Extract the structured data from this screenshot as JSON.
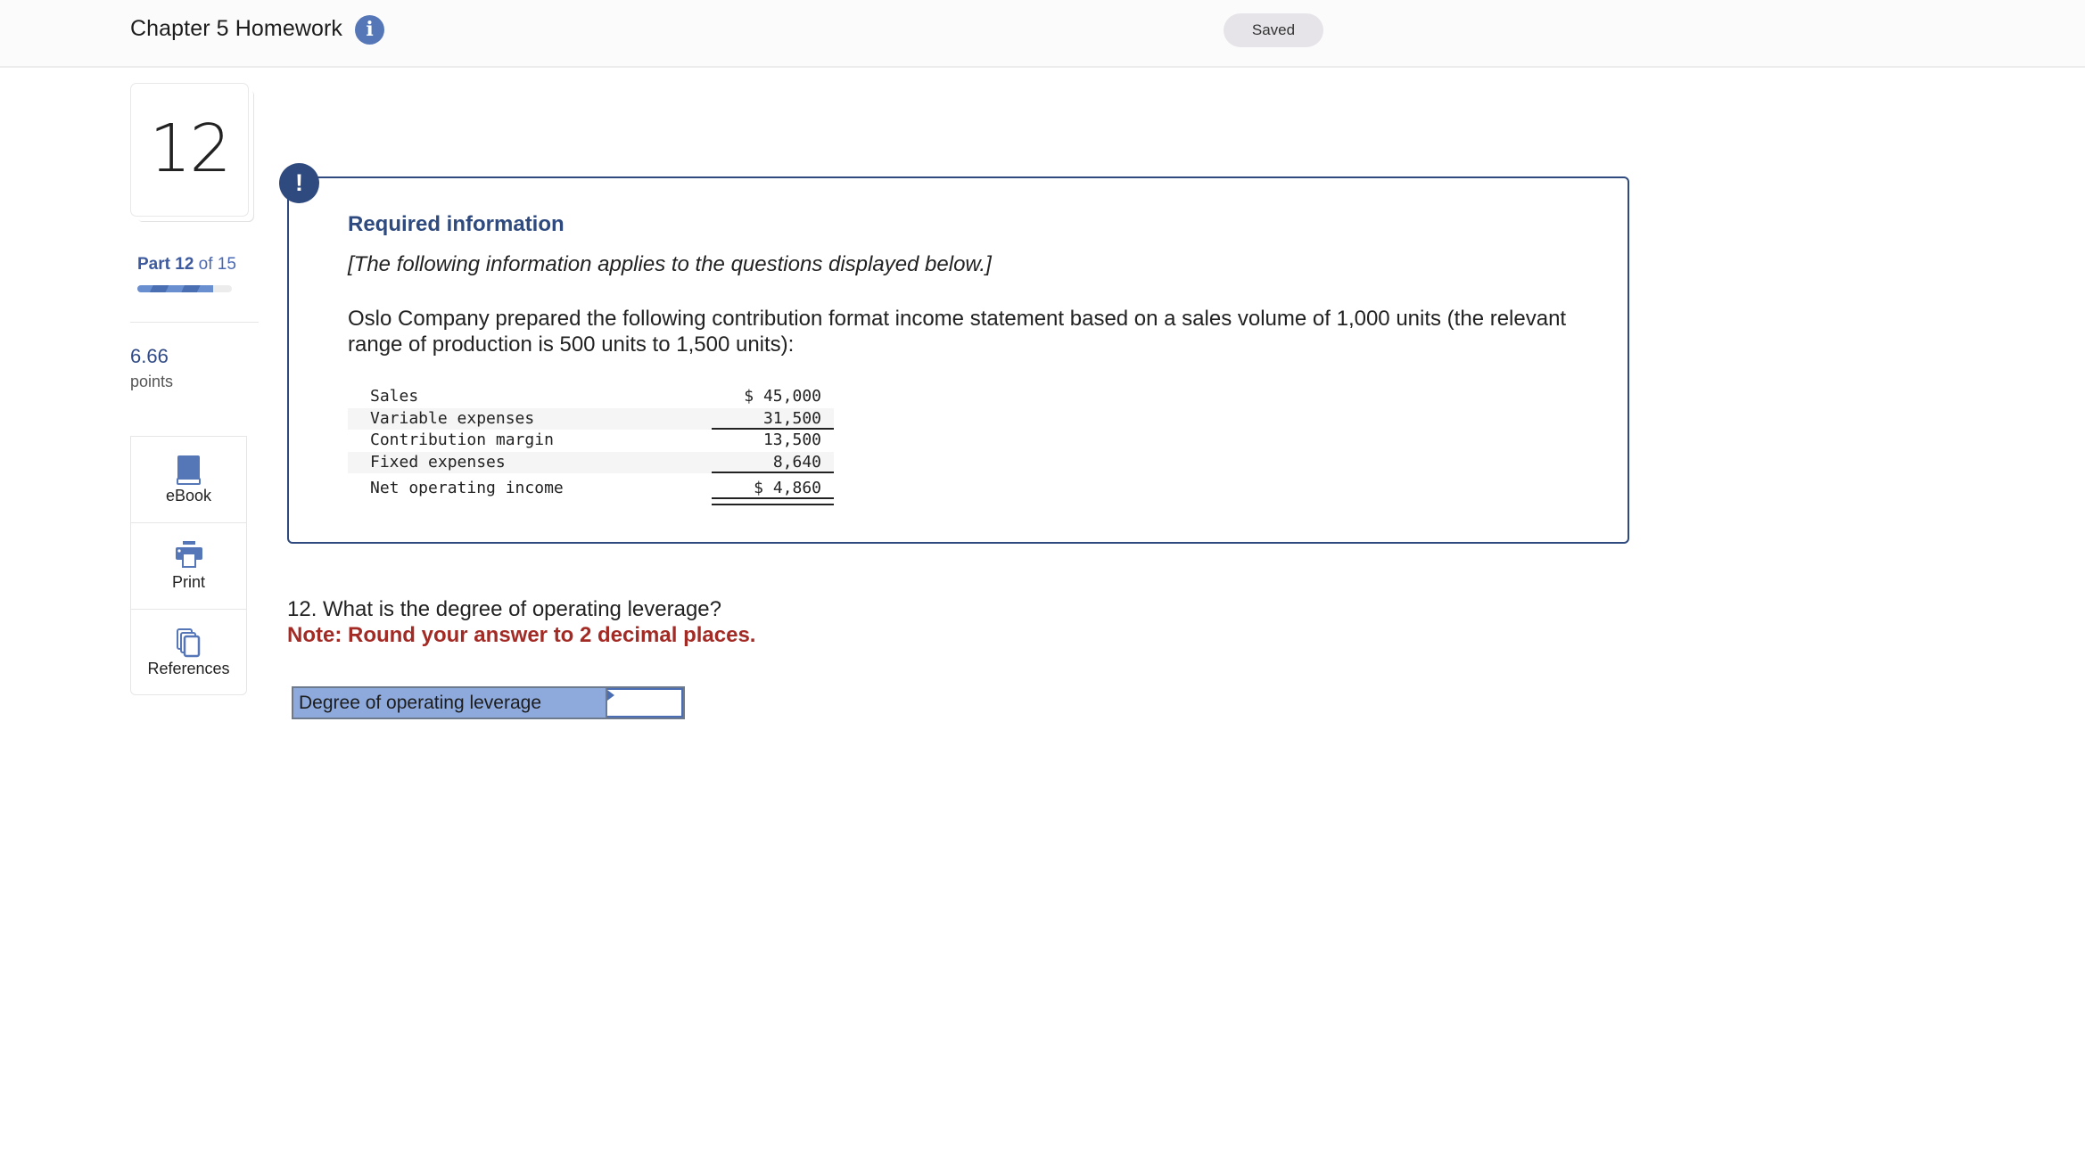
{
  "header": {
    "title": "Chapter 5 Homework",
    "info_icon": "info-icon",
    "save_status": "Saved"
  },
  "question_nav": {
    "number": "12",
    "part_prefix": "Part",
    "part_current": "12",
    "part_suffix": "of 15",
    "progress": {
      "current": 12,
      "total": 15
    },
    "points_value": "6.66",
    "points_label": "points"
  },
  "tools": [
    {
      "label": "eBook",
      "icon": "book-icon"
    },
    {
      "label": "Print",
      "icon": "printer-icon"
    },
    {
      "label": "References",
      "icon": "copy-pages-icon"
    }
  ],
  "required_info": {
    "badge": "!",
    "title": "Required information",
    "subtitle": "[The following information applies to the questions displayed below.]",
    "paragraph": "Oslo Company prepared the following contribution format income statement based on a sales volume of 1,000 units (the relevant range of production is 500 units to 1,500 units):",
    "statement": [
      {
        "label": "Sales",
        "amount": "$ 45,000"
      },
      {
        "label": "Variable expenses",
        "amount": "31,500"
      },
      {
        "label": "Contribution margin",
        "amount": "13,500"
      },
      {
        "label": "Fixed expenses",
        "amount": "8,640"
      },
      {
        "label": "Net operating income",
        "amount": "$ 4,860"
      }
    ]
  },
  "question": {
    "text": "12. What is the degree of operating leverage?",
    "note": "Note: Round your answer to 2 decimal places."
  },
  "answer": {
    "label": "Degree of operating leverage",
    "value": ""
  },
  "colors": {
    "brand_blue": "#2f4a7e",
    "accent_blue": "#5577b8",
    "note_red": "#a32b26",
    "answer_label_bg": "#8eaadd"
  }
}
